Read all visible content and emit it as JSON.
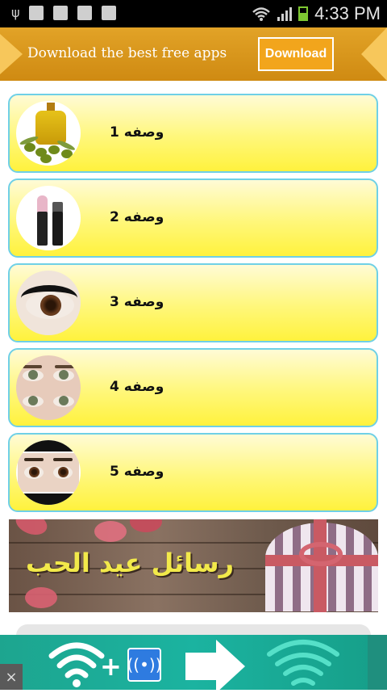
{
  "status_bar": {
    "time": "4:33 PM",
    "icons": [
      "usb-icon",
      "sd-card-icon",
      "screenshot-icon",
      "store-icon",
      "download-icon",
      "wifi-icon",
      "signal-icon",
      "battery-icon"
    ]
  },
  "top_banner": {
    "text": "Download the best free apps",
    "button_label": "Download",
    "accent_color": "#e2a327"
  },
  "list": {
    "items": [
      {
        "label": "وصفه 1",
        "thumb": "olive-oil-image"
      },
      {
        "label": "وصفه 2",
        "thumb": "lipstick-image"
      },
      {
        "label": "وصفه 3",
        "thumb": "eyelashes-image"
      },
      {
        "label": "وصفه 4",
        "thumb": "eyes-image"
      },
      {
        "label": "وصفه 5",
        "thumb": "eyebrows-image"
      }
    ],
    "item_border_color": "#6fd0e6",
    "item_fill_color": "#fff23d"
  },
  "valentine_banner": {
    "text": "رسائل عيد الحب"
  },
  "bottom_ad": {
    "close_label": "×",
    "accent_color": "#1bb3a0"
  }
}
